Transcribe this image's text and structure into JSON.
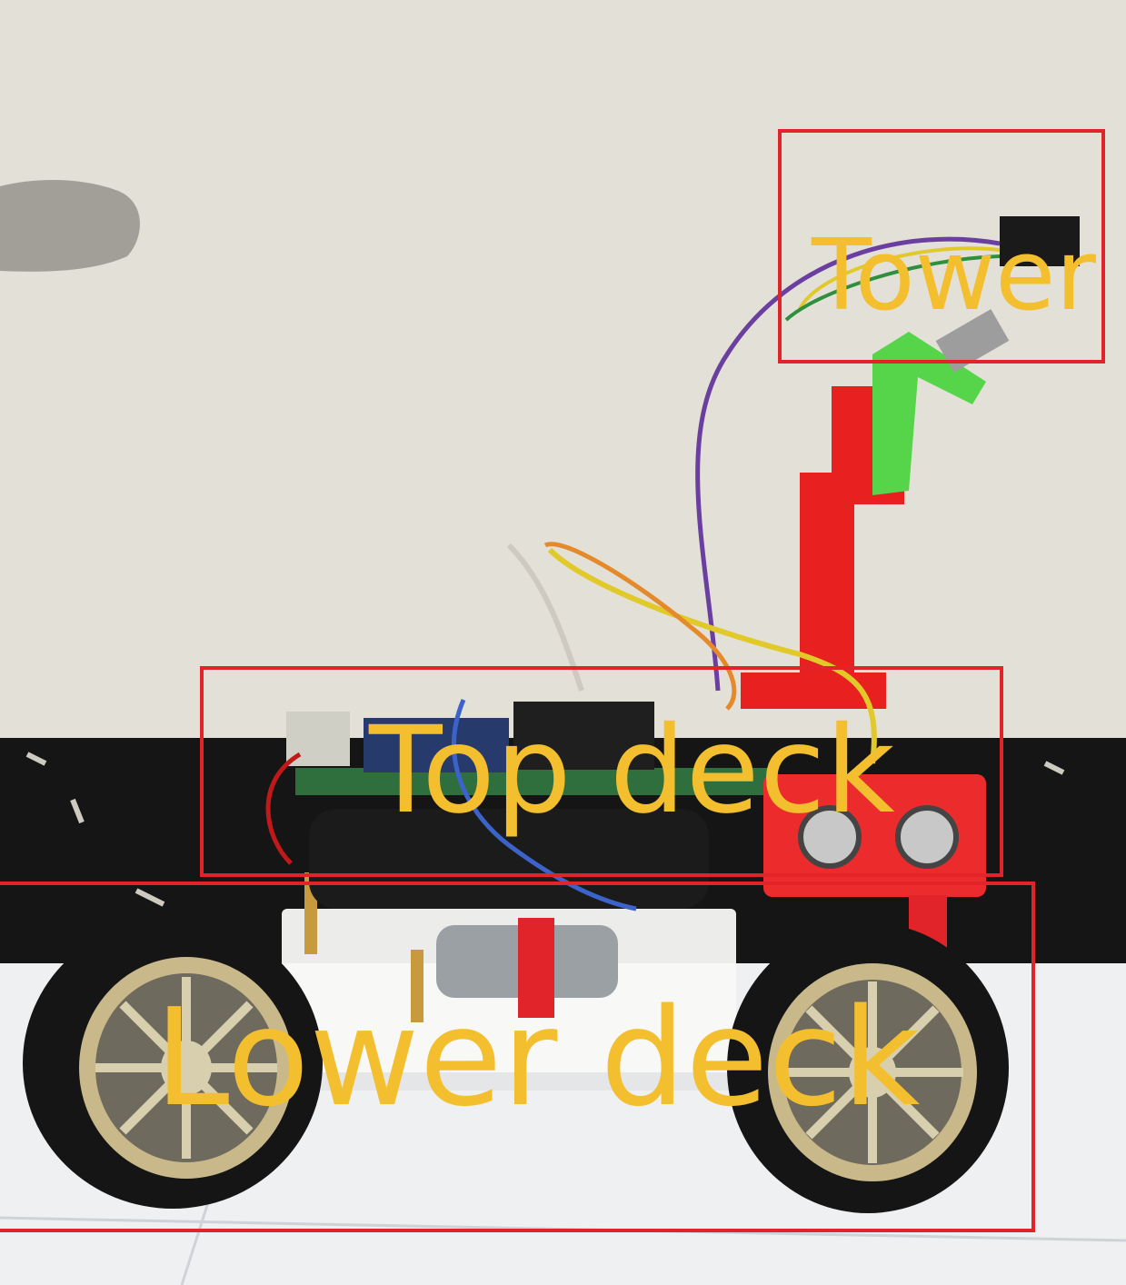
{
  "colors": {
    "box_outline": "#e0242a",
    "label_text": "#f4bf2e",
    "wall": "#e9e6df",
    "skirting": "#151515",
    "floor": "#eef0f2"
  },
  "regions": {
    "tower": {
      "label": "Tower"
    },
    "top_deck": {
      "label": "Top deck"
    },
    "lower_deck": {
      "label": "Lower deck"
    }
  }
}
